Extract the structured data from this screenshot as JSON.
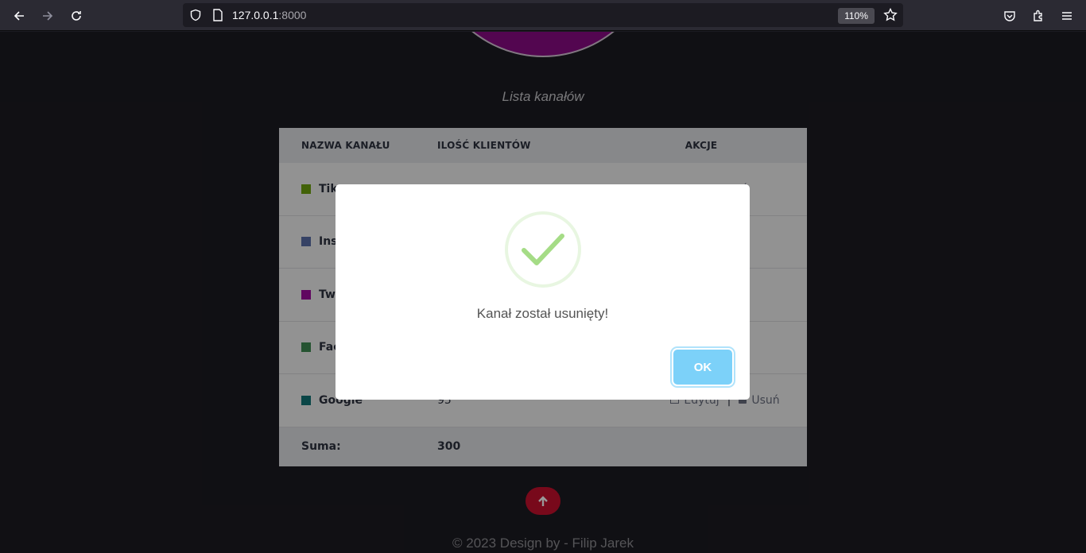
{
  "browser": {
    "url_host": "127.0.0.1",
    "url_port": ":8000",
    "zoom": "110%"
  },
  "page": {
    "caption": "Lista kanałów",
    "table": {
      "headers": [
        "NAZWA KANAŁU",
        "ILOŚĆ KLIENTÓW",
        "AKCJE"
      ],
      "rows": [
        {
          "name": "Tik",
          "clients": "",
          "color": "#6fa30e"
        },
        {
          "name": "Ins",
          "clients": "",
          "color": "#5a6fa8"
        },
        {
          "name": "Twi",
          "clients": "",
          "color": "#a10aa0"
        },
        {
          "name": "Fac",
          "clients": "",
          "color": "#3f8a52"
        },
        {
          "name": "Google",
          "clients": "95",
          "color": "#117577"
        }
      ],
      "edit_label": "Edytuj",
      "delete_label": "Usuń",
      "delete_partial": "ń",
      "separator": "|",
      "sum_label": "Suma:",
      "sum_value": "300"
    },
    "footer": "© 2023 Design by - Filip Jarek"
  },
  "modal": {
    "message": "Kanał został usunięty!",
    "ok_label": "OK",
    "icon": "success-check-icon"
  }
}
